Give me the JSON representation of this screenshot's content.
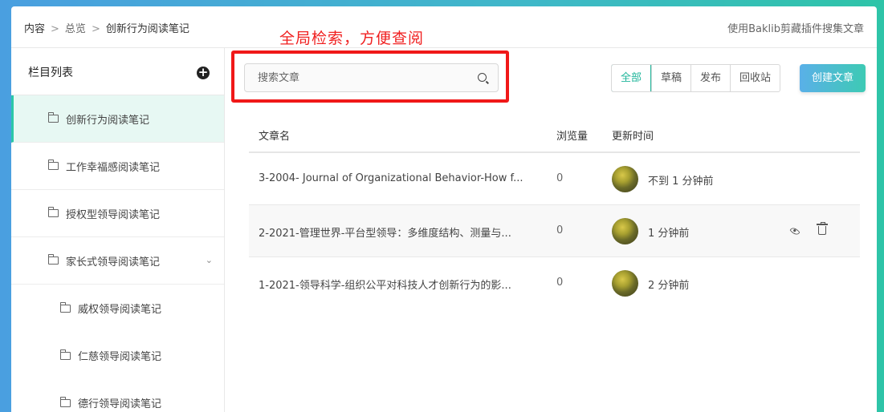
{
  "breadcrumb": [
    "内容",
    "总览",
    "创新行为阅读笔记"
  ],
  "plugin_link": "使用Baklib剪藏插件搜集文章",
  "annotation": "全局检索，方便查阅",
  "sidebar": {
    "title": "栏目列表",
    "items": [
      {
        "label": "创新行为阅读笔记",
        "active": true
      },
      {
        "label": "工作幸福感阅读笔记"
      },
      {
        "label": "授权型领导阅读笔记"
      },
      {
        "label": "家长式领导阅读笔记",
        "expandable": true
      },
      {
        "label": "威权领导阅读笔记",
        "sub": true
      },
      {
        "label": "仁慈领导阅读笔记",
        "sub": true
      },
      {
        "label": "德行领导阅读笔记",
        "sub": true
      }
    ]
  },
  "search": {
    "placeholder": "搜索文章"
  },
  "filters": [
    "全部",
    "草稿",
    "发布",
    "回收站"
  ],
  "create_button": "创建文章",
  "table": {
    "headers": [
      "文章名",
      "浏览量",
      "更新时间"
    ],
    "rows": [
      {
        "name": "3-2004- Journal of Organizational Behavior-How f...",
        "views": "0",
        "time": "不到 1 分钟前"
      },
      {
        "name": "2-2021-管理世界-平台型领导：多维度结构、测量与...",
        "views": "0",
        "time": "1 分钟前"
      },
      {
        "name": "1-2021-领导科学-组织公平对科技人才创新行为的影...",
        "views": "0",
        "time": "2 分钟前"
      }
    ]
  },
  "colors": {
    "accent": "#1fb59a",
    "annotation": "#f01818"
  }
}
